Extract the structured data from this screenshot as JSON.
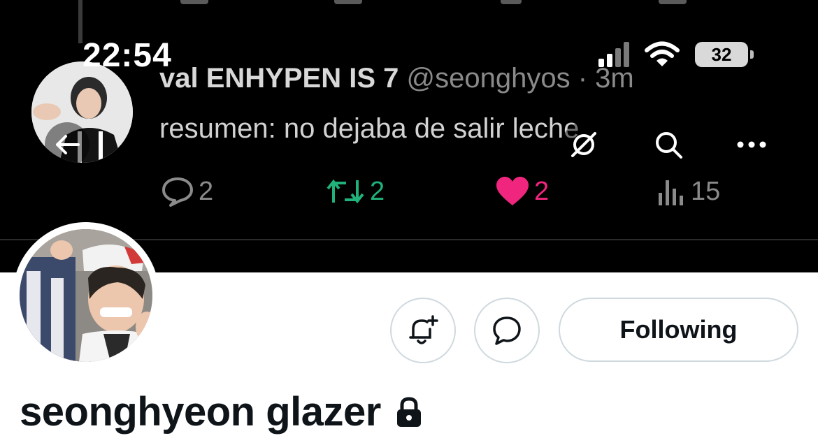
{
  "status_bar": {
    "time": "22:54",
    "battery": "32",
    "icons": [
      "cellular-signal-icon",
      "wifi-icon",
      "battery-icon"
    ]
  },
  "banner": {
    "tweet": {
      "display_name": "val ENHYPEN IS 7",
      "handle": "@seonghyos",
      "time_ago": "· 3m",
      "text": "resumen: no dejaba de salir leche",
      "replies": "2",
      "retweets": "2",
      "likes": "2",
      "views": "15"
    },
    "colors": {
      "retweet": "#20b27a",
      "like": "#f0267e",
      "muted": "#8a8a8a"
    }
  },
  "nav": {
    "icons": [
      "back-arrow-icon",
      "grok-icon",
      "search-icon",
      "more-options-icon"
    ]
  },
  "profile": {
    "display_name": "seonghyeon glazer",
    "following_label": "Following",
    "locked": true,
    "icons": [
      "notification-bell-icon",
      "message-icon",
      "lock-icon"
    ]
  }
}
